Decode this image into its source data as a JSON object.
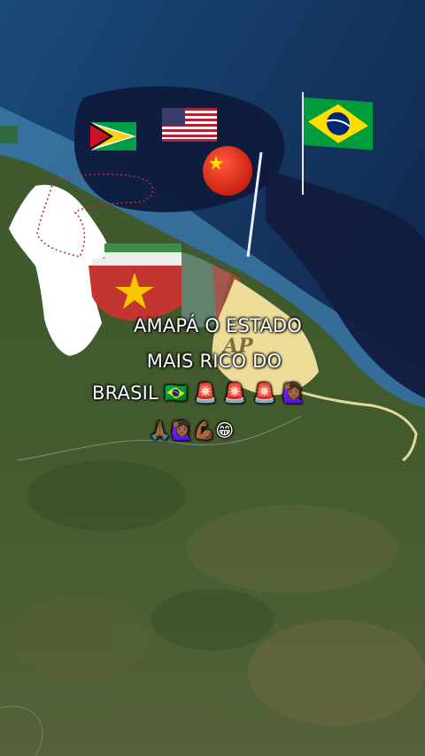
{
  "caption": {
    "line1": "AMAPÁ O ESTADO",
    "line2": "MAIS RICO DO",
    "line3": "BRASIL 🇧🇷 🚨 🚨 🚨 🙋🏾‍♀️",
    "line4": "🙏🏾🙋🏾‍♀️💪🏾😁"
  },
  "map_labels": {
    "amapa_abbrev": "AP"
  },
  "flags": [
    "guyana-flag",
    "usa-flag",
    "china-flag",
    "brazil-flag",
    "suriname-flag"
  ],
  "colors": {
    "ocean_deep": "#0d1b3a",
    "ocean_shelf": "#3a78a0",
    "land_green": "#3f5a2a",
    "guyana_white": "#ffffff",
    "amapa_yellow": "#efe09a",
    "suriname_red": "#b8322e"
  }
}
